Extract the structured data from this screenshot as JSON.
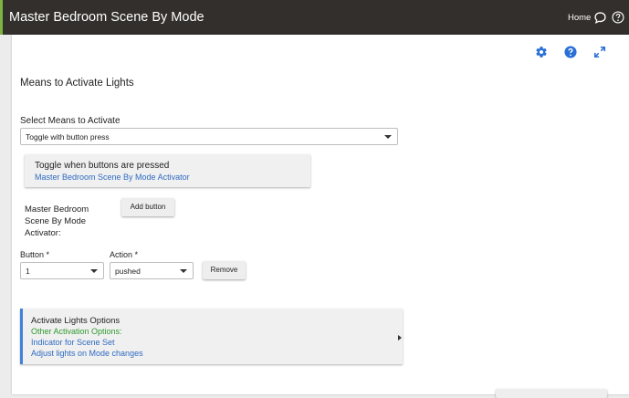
{
  "topbar": {
    "title": "Master Bedroom Scene By Mode",
    "home": "Home",
    "icons": [
      "chat-icon",
      "help-circle-icon"
    ],
    "bg_color": "#322f2c",
    "accent_color": "#7cb342"
  },
  "toolbar": {
    "icons": [
      "gear-icon",
      "help-icon",
      "expand-icon"
    ],
    "icon_color": "#2a6fd6"
  },
  "section": {
    "title": "Means to Activate Lights"
  },
  "means": {
    "label": "Select Means to Activate",
    "value": "Toggle with button press"
  },
  "toggle": {
    "title": "Toggle when buttons are pressed",
    "link": "Master Bedroom Scene By Mode Activator"
  },
  "activator": {
    "label": "Master Bedroom Scene By Mode Activator:",
    "add_button": "Add button"
  },
  "button_row": {
    "button_label": "Button *",
    "button_value": "1",
    "action_label": "Action *",
    "action_value": "pushed",
    "remove_button": "Remove"
  },
  "options": {
    "title": "Activate Lights Options",
    "subtitle": "Other Activation Options:",
    "items": [
      "Indicator for Scene Set",
      "Adjust lights on Mode changes"
    ],
    "accent_color": "#3f83d6",
    "subtitle_color": "#2e9a2e",
    "link_color": "#2e6bc2"
  }
}
